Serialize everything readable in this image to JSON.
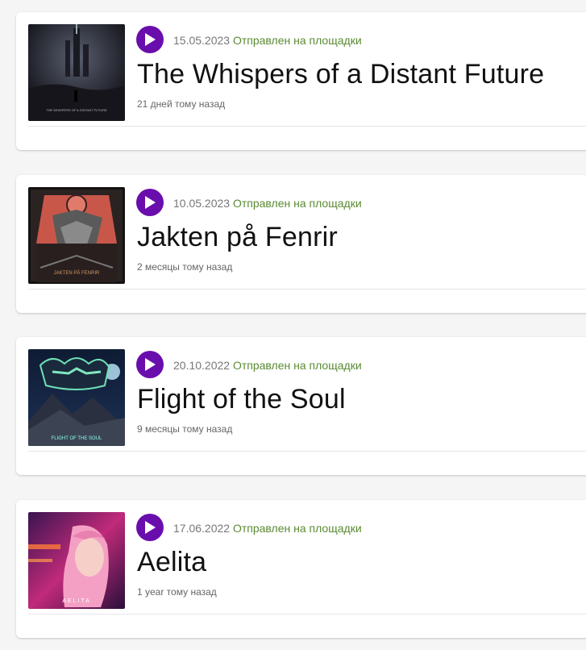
{
  "releases": [
    {
      "date": "15.05.2023",
      "status": "Отправлен на площадки",
      "title": "The Whispers of a Distant Future",
      "ago": "21 дней тому назад",
      "cover_icon": "album-cover-whispers"
    },
    {
      "date": "10.05.2023",
      "status": "Отправлен на площадки",
      "title": "Jakten på Fenrir",
      "ago": "2 месяцы тому назад",
      "cover_icon": "album-cover-fenrir"
    },
    {
      "date": "20.10.2022",
      "status": "Отправлен на площадки",
      "title": "Flight of the Soul",
      "ago": "9 месяцы тому назад",
      "cover_icon": "album-cover-flight"
    },
    {
      "date": "17.06.2022",
      "status": "Отправлен на площадки",
      "title": "Aelita",
      "ago": "1 year тому назад",
      "cover_icon": "album-cover-aelita"
    }
  ],
  "colors": {
    "play_button": "#6a0dad",
    "status_text": "#5a8a32",
    "date_text": "#777777"
  }
}
